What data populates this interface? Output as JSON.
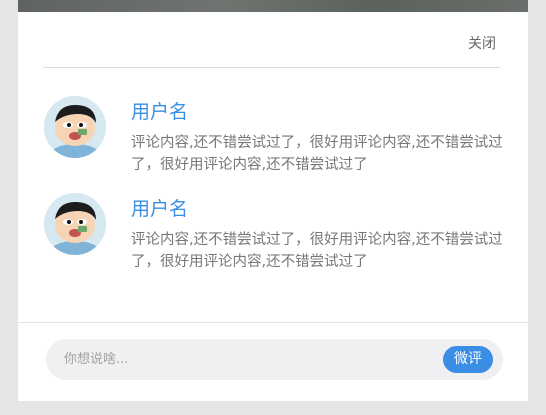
{
  "dialog": {
    "close_label": "关闭"
  },
  "comments": [
    {
      "username": "用户名",
      "text": "评论内容,还不错尝试过了，很好用评论内容,还不错尝试过了，很好用评论内容,还不错尝试过了"
    },
    {
      "username": "用户名",
      "text": "评论内容,还不错尝试过了，很好用评论内容,还不错尝试过了，很好用评论内容,还不错尝试过了"
    }
  ],
  "composer": {
    "placeholder": "你想说啥...",
    "send_label": "微评"
  },
  "colors": {
    "accent": "#3a8ee6",
    "text_muted": "#777777"
  }
}
